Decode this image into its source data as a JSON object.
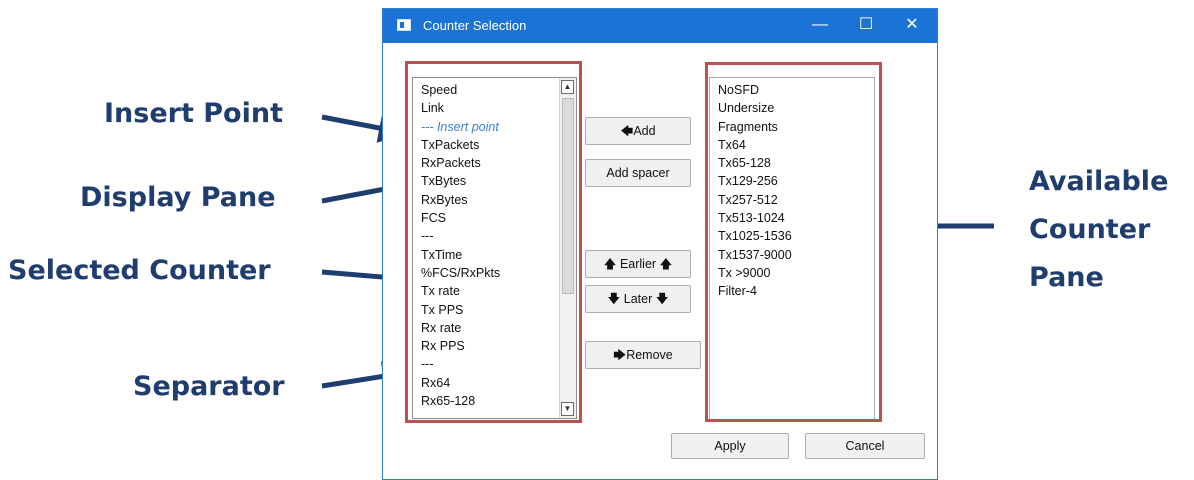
{
  "window": {
    "title": "Counter Selection",
    "minimize_glyph": "—",
    "maximize_glyph": "☐",
    "close_glyph": "✕"
  },
  "display_pane": {
    "items": [
      {
        "label": "Speed",
        "kind": "counter"
      },
      {
        "label": "Link",
        "kind": "counter"
      },
      {
        "label": "--- Insert point",
        "kind": "insert-point"
      },
      {
        "label": "TxPackets",
        "kind": "counter"
      },
      {
        "label": "RxPackets",
        "kind": "counter"
      },
      {
        "label": "TxBytes",
        "kind": "counter"
      },
      {
        "label": "RxBytes",
        "kind": "counter"
      },
      {
        "label": "FCS",
        "kind": "counter"
      },
      {
        "label": "---",
        "kind": "separator"
      },
      {
        "label": "TxTime",
        "kind": "counter"
      },
      {
        "label": "%FCS/RxPkts",
        "kind": "counter"
      },
      {
        "label": "Tx rate",
        "kind": "counter"
      },
      {
        "label": "Tx PPS",
        "kind": "counter"
      },
      {
        "label": "Rx rate",
        "kind": "counter"
      },
      {
        "label": "Rx PPS",
        "kind": "counter"
      },
      {
        "label": "---",
        "kind": "separator"
      },
      {
        "label": "Rx64",
        "kind": "counter"
      },
      {
        "label": "Rx65-128",
        "kind": "counter"
      }
    ]
  },
  "available_pane": {
    "items": [
      "NoSFD",
      "Undersize",
      "Fragments",
      "Tx64",
      "Tx65-128",
      "Tx129-256",
      "Tx257-512",
      "Tx513-1024",
      "Tx1025-1536",
      "Tx1537-9000",
      "Tx >9000",
      "Filter-4"
    ]
  },
  "buttons": {
    "add": "Add",
    "add_spacer": "Add spacer",
    "earlier": "Earlier",
    "later": "Later",
    "remove": "Remove",
    "apply": "Apply",
    "cancel": "Cancel"
  },
  "callouts": {
    "insert_point": "Insert Point",
    "display_pane": "Display Pane",
    "selected_counter": "Selected Counter",
    "separator": "Separator",
    "available_pane": "Available\nCounter\nPane"
  },
  "colors": {
    "callout_text": "#1f3d6e",
    "highlight_box": "#c0504d",
    "title_bar": "#1c73d6",
    "insert_point_text": "#3a7fd8"
  }
}
